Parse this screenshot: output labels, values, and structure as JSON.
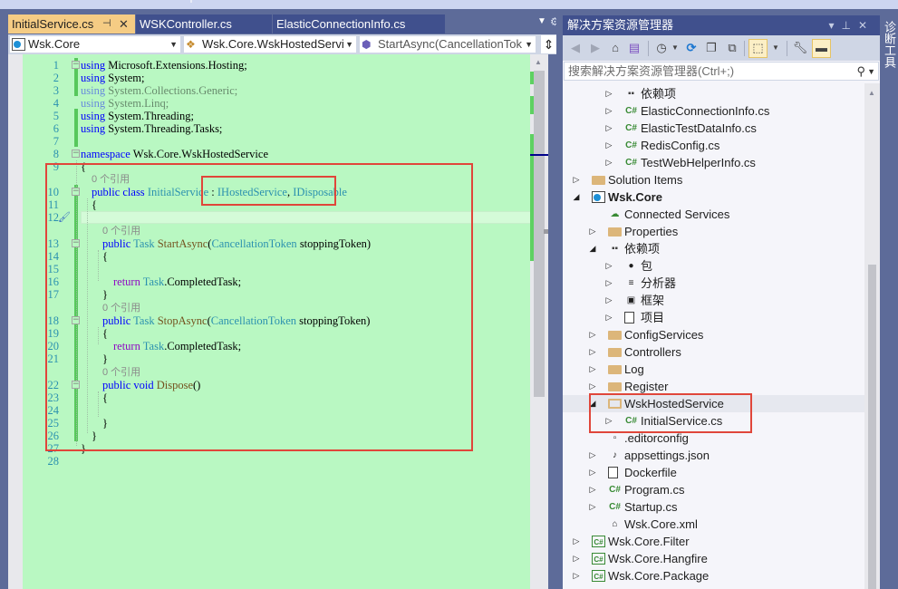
{
  "editor": {
    "tabs": [
      {
        "label": "InitialService.cs",
        "active": true,
        "pin_icon": "pin-icon",
        "close_icon": "close-icon"
      },
      {
        "label": "WSKController.cs",
        "active": false
      },
      {
        "label": "ElasticConnectionInfo.cs",
        "active": false
      }
    ],
    "tab_overflow_icon": "dropdown-icon",
    "tab_settings_icon": "gear-icon",
    "nav": {
      "project": "Wsk.Core",
      "type": "Wsk.Core.WskHostedServi",
      "member": "StartAsync(CancellationTok",
      "split_icon": "split-icon"
    },
    "lines": [
      {
        "n": "1",
        "code": [
          {
            "t": "using",
            "c": "kw"
          },
          {
            "t": " Microsoft.Extensions.Hosting;"
          }
        ]
      },
      {
        "n": "2",
        "code": [
          {
            "t": "using",
            "c": "kw"
          },
          {
            "t": " System;"
          }
        ]
      },
      {
        "n": "3",
        "code": [
          {
            "t": "using",
            "c": "kw"
          },
          {
            "t": " System.Collections.Generic;"
          }
        ],
        "faded": true
      },
      {
        "n": "4",
        "code": [
          {
            "t": "using",
            "c": "kw"
          },
          {
            "t": " System.Linq;"
          }
        ],
        "faded": true
      },
      {
        "n": "5",
        "code": [
          {
            "t": "using",
            "c": "kw"
          },
          {
            "t": " System.Threading;"
          }
        ]
      },
      {
        "n": "6",
        "code": [
          {
            "t": "using",
            "c": "kw"
          },
          {
            "t": " System.Threading.Tasks;"
          }
        ]
      },
      {
        "n": "7",
        "code": []
      },
      {
        "n": "8",
        "code": [
          {
            "t": "namespace",
            "c": "kw"
          },
          {
            "t": " Wsk.Core.WskHostedService"
          }
        ]
      },
      {
        "n": "9",
        "code": [
          {
            "t": "{"
          }
        ]
      },
      {
        "n": "10",
        "code": [
          {
            "t": "public",
            "c": "kw"
          },
          {
            "t": " "
          },
          {
            "t": "class",
            "c": "kw"
          },
          {
            "t": " "
          },
          {
            "t": "InitialService",
            "c": "ty"
          },
          {
            "t": " : "
          },
          {
            "t": "IHostedService",
            "c": "ty"
          },
          {
            "t": ", "
          },
          {
            "t": "IDisposable",
            "c": "ty"
          }
        ]
      },
      {
        "n": "11",
        "code": [
          {
            "t": "{"
          }
        ]
      },
      {
        "n": "12",
        "code": []
      },
      {
        "n": "13",
        "code": [
          {
            "t": "public",
            "c": "kw"
          },
          {
            "t": " "
          },
          {
            "t": "Task",
            "c": "ty"
          },
          {
            "t": " "
          },
          {
            "t": "StartAsync",
            "c": "fn"
          },
          {
            "t": "("
          },
          {
            "t": "CancellationToken",
            "c": "ty"
          },
          {
            "t": " stoppingToken)"
          }
        ]
      },
      {
        "n": "14",
        "code": [
          {
            "t": "{"
          }
        ]
      },
      {
        "n": "15",
        "code": []
      },
      {
        "n": "16",
        "code": [
          {
            "t": "return",
            "c": "ctl"
          },
          {
            "t": " "
          },
          {
            "t": "Task",
            "c": "ty"
          },
          {
            "t": ".CompletedTask;"
          }
        ]
      },
      {
        "n": "17",
        "code": [
          {
            "t": "}"
          }
        ]
      },
      {
        "n": "18",
        "code": [
          {
            "t": "public",
            "c": "kw"
          },
          {
            "t": " "
          },
          {
            "t": "Task",
            "c": "ty"
          },
          {
            "t": " "
          },
          {
            "t": "StopAsync",
            "c": "fn"
          },
          {
            "t": "("
          },
          {
            "t": "CancellationToken",
            "c": "ty"
          },
          {
            "t": " stoppingToken)"
          }
        ]
      },
      {
        "n": "19",
        "code": [
          {
            "t": "{"
          }
        ]
      },
      {
        "n": "20",
        "code": [
          {
            "t": "return",
            "c": "ctl"
          },
          {
            "t": " "
          },
          {
            "t": "Task",
            "c": "ty"
          },
          {
            "t": ".CompletedTask;"
          }
        ]
      },
      {
        "n": "21",
        "code": [
          {
            "t": "}"
          }
        ]
      },
      {
        "n": "22",
        "code": [
          {
            "t": "public",
            "c": "kw"
          },
          {
            "t": " "
          },
          {
            "t": "void",
            "c": "kw"
          },
          {
            "t": " "
          },
          {
            "t": "Dispose",
            "c": "fn"
          },
          {
            "t": "()"
          }
        ]
      },
      {
        "n": "23",
        "code": [
          {
            "t": "{"
          }
        ]
      },
      {
        "n": "24",
        "code": []
      },
      {
        "n": "25",
        "code": [
          {
            "t": "}"
          }
        ]
      },
      {
        "n": "26",
        "code": [
          {
            "t": "}"
          }
        ]
      },
      {
        "n": "27",
        "code": [
          {
            "t": "}"
          }
        ]
      },
      {
        "n": "28",
        "code": []
      }
    ],
    "codelens": "0 个引用"
  },
  "solution_explorer": {
    "title": "解决方案资源管理器",
    "title_controls": [
      "dropdown-icon",
      "pin-icon",
      "close-icon"
    ],
    "toolbar": [
      "back-icon",
      "forward-icon",
      "home-icon",
      "vs-solution-icon",
      "history-icon",
      "dropdown-icon",
      "sync-icon",
      "collapse-all-icon",
      "show-all-files-icon",
      "track-active-icon",
      "dropdown-icon",
      "properties-wrench-icon",
      "preview-icon"
    ],
    "search_placeholder": "搜索解决方案资源管理器(Ctrl+;)",
    "tree": [
      {
        "label": "依赖项",
        "icon": "dependencies-icon",
        "level": 2,
        "twisty": "collapsed"
      },
      {
        "label": "ElasticConnectionInfo.cs",
        "icon": "csharp-file-icon",
        "level": 2,
        "twisty": "collapsed"
      },
      {
        "label": "ElasticTestDataInfo.cs",
        "icon": "csharp-file-icon",
        "level": 2,
        "twisty": "collapsed"
      },
      {
        "label": "RedisConfig.cs",
        "icon": "csharp-file-icon",
        "level": 2,
        "twisty": "collapsed"
      },
      {
        "label": "TestWebHelperInfo.cs",
        "icon": "csharp-file-icon",
        "level": 2,
        "twisty": "collapsed"
      },
      {
        "label": "Solution Items",
        "icon": "folder-icon",
        "level": 0,
        "twisty": "collapsed"
      },
      {
        "label": "Wsk.Core",
        "icon": "web-project-icon",
        "level": 0,
        "twisty": "expanded",
        "bold": true
      },
      {
        "label": "Connected Services",
        "icon": "connected-services-icon",
        "level": 1,
        "twisty": "none"
      },
      {
        "label": "Properties",
        "icon": "properties-folder-icon",
        "level": 1,
        "twisty": "collapsed"
      },
      {
        "label": "依赖项",
        "icon": "dependencies-icon",
        "level": 1,
        "twisty": "expanded"
      },
      {
        "label": "包",
        "icon": "package-icon",
        "level": 2,
        "twisty": "collapsed"
      },
      {
        "label": "分析器",
        "icon": "analyzer-icon",
        "level": 2,
        "twisty": "collapsed"
      },
      {
        "label": "框架",
        "icon": "framework-icon",
        "level": 2,
        "twisty": "collapsed"
      },
      {
        "label": "项目",
        "icon": "project-ref-icon",
        "level": 2,
        "twisty": "collapsed"
      },
      {
        "label": "ConfigServices",
        "icon": "folder-icon",
        "level": 1,
        "twisty": "collapsed"
      },
      {
        "label": "Controllers",
        "icon": "folder-icon",
        "level": 1,
        "twisty": "collapsed"
      },
      {
        "label": "Log",
        "icon": "folder-icon",
        "level": 1,
        "twisty": "collapsed"
      },
      {
        "label": "Register",
        "icon": "folder-icon",
        "level": 1,
        "twisty": "collapsed"
      },
      {
        "label": "WskHostedService",
        "icon": "folder-open-icon",
        "level": 1,
        "twisty": "expanded",
        "selected": true
      },
      {
        "label": "InitialService.cs",
        "icon": "csharp-file-icon",
        "level": 2,
        "twisty": "collapsed"
      },
      {
        "label": ".editorconfig",
        "icon": "editorconfig-icon",
        "level": 1,
        "twisty": "none"
      },
      {
        "label": "appsettings.json",
        "icon": "json-file-icon",
        "level": 1,
        "twisty": "collapsed"
      },
      {
        "label": "Dockerfile",
        "icon": "file-icon",
        "level": 1,
        "twisty": "collapsed"
      },
      {
        "label": "Program.cs",
        "icon": "csharp-file-icon",
        "level": 1,
        "twisty": "collapsed"
      },
      {
        "label": "Startup.cs",
        "icon": "csharp-file-icon",
        "level": 1,
        "twisty": "collapsed"
      },
      {
        "label": "Wsk.Core.xml",
        "icon": "xml-file-icon",
        "level": 1,
        "twisty": "none"
      },
      {
        "label": "Wsk.Core.Filter",
        "icon": "csharp-project-icon",
        "level": 0,
        "twisty": "collapsed"
      },
      {
        "label": "Wsk.Core.Hangfire",
        "icon": "csharp-project-icon",
        "level": 0,
        "twisty": "collapsed"
      },
      {
        "label": "Wsk.Core.Package",
        "icon": "csharp-project-icon",
        "level": 0,
        "twisty": "collapsed"
      }
    ]
  },
  "side_rail": {
    "label": "诊断工具"
  },
  "colors": {
    "editor_bg": "#b9f8c2",
    "active_tab": "#f5cc84",
    "chrome": "#5d6b99",
    "annotation": "#e0463a"
  }
}
